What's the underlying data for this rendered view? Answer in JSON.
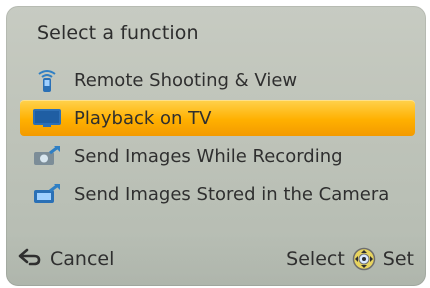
{
  "title": "Select a function",
  "menu": {
    "items": [
      {
        "label": "Remote Shooting & View",
        "icon": "remote-shooting-icon"
      },
      {
        "label": "Playback on TV",
        "icon": "tv-icon",
        "selected": true
      },
      {
        "label": "Send Images While Recording",
        "icon": "send-recording-icon"
      },
      {
        "label": "Send Images Stored in the Camera",
        "icon": "send-stored-icon"
      }
    ]
  },
  "footer": {
    "cancel_label": "Cancel",
    "select_label": "Select",
    "set_label": "Set"
  },
  "colors": {
    "background": "#c3c8bf",
    "selection": "#ffb000",
    "text": "#2f2f2f"
  }
}
